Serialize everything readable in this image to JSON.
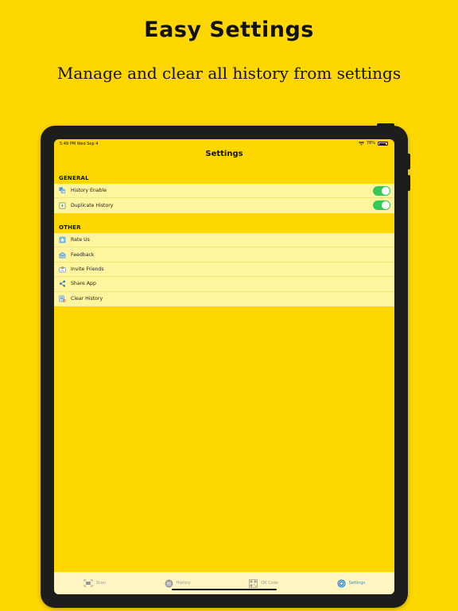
{
  "promo": {
    "headline": "Easy Settings",
    "subline": "Manage and clear all history from settings"
  },
  "status": {
    "time": "5:49 PM  Wed Sep 4",
    "battery": "78%",
    "battery_level": 0.78
  },
  "nav": {
    "title": "Settings"
  },
  "general": {
    "header": "GENERAL",
    "items": [
      {
        "label": "History Enable",
        "icon": "history-enable-icon",
        "toggle_on": true
      },
      {
        "label": "Duplicate History",
        "icon": "duplicate-icon",
        "toggle_on": true
      }
    ]
  },
  "other": {
    "header": "OTHER",
    "items": [
      {
        "label": "Rate Us",
        "icon": "star-icon"
      },
      {
        "label": "Feedback",
        "icon": "mail-icon"
      },
      {
        "label": "Invite Friends",
        "icon": "invite-icon"
      },
      {
        "label": "Share App",
        "icon": "share-icon"
      },
      {
        "label": "Clear History",
        "icon": "clear-history-icon"
      }
    ]
  },
  "tabs": [
    {
      "label": "Scan",
      "icon": "scan-icon",
      "active": false
    },
    {
      "label": "History",
      "icon": "history-icon",
      "active": false
    },
    {
      "label": "QR Code",
      "icon": "qr-code-icon",
      "active": false
    },
    {
      "label": "Settings",
      "icon": "gear-icon",
      "active": true
    }
  ],
  "colors": {
    "background": "#FFD700",
    "row_background": "#FFF59E",
    "toggle_on": "#34C759",
    "tab_active": "#2D8CD7",
    "tab_inactive": "#999999"
  }
}
